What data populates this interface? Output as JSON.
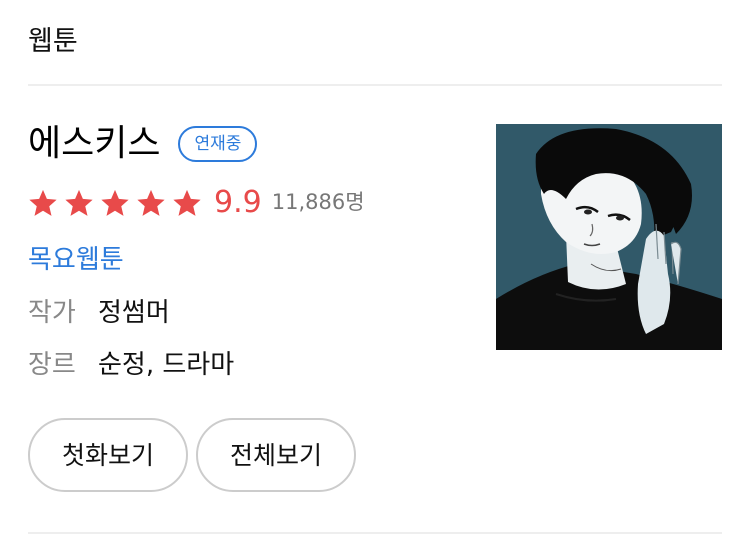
{
  "section": {
    "title": "웹툰"
  },
  "webtoon": {
    "title": "에스키스",
    "status_badge": "연재중",
    "rating": {
      "stars": 5,
      "max_stars": 5,
      "score": "9.9",
      "count": "11,886명"
    },
    "day_link": "목요웹툰",
    "author": {
      "label": "작가",
      "value": "정썸머"
    },
    "genre": {
      "label": "장르",
      "value": "순정, 드라마"
    },
    "buttons": {
      "first_episode": "첫화보기",
      "all_episodes": "전체보기"
    }
  },
  "colors": {
    "accent_blue": "#2d7bdb",
    "rating_red": "#e84a4a",
    "thumbnail_bg": "#2f5666"
  }
}
